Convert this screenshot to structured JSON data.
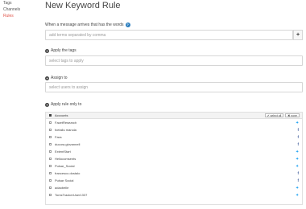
{
  "sidebar": {
    "items": [
      {
        "label": "Tags",
        "active": false
      },
      {
        "label": "Channels",
        "active": false
      },
      {
        "label": "Rules",
        "active": true
      }
    ]
  },
  "page": {
    "title": "New Keyword Rule"
  },
  "keywords": {
    "label": "When a message arrives that has the words",
    "placeholder": "add terms separated by comma",
    "add_button": "+"
  },
  "apply_tags": {
    "label": "Apply the tags",
    "placeholder": "select tags to apply"
  },
  "assign": {
    "label": "Assign to",
    "placeholder": "select users to assign"
  },
  "apply_rule": {
    "label": "Apply rule only to",
    "header_label": "Accounts",
    "select_all": "select all",
    "none": "none",
    "accounts": [
      {
        "name": "FacetResearch",
        "network": "twitter"
      },
      {
        "name": "fcetallu manola",
        "network": "facebook"
      },
      {
        "name": "Facs",
        "network": "facebook"
      },
      {
        "name": "ducora.giovannell",
        "network": "facebook"
      },
      {
        "name": "ExtentStart",
        "network": "twitter"
      },
      {
        "name": "Hellocomsents",
        "network": "twitter"
      },
      {
        "name": "Pulsar_Social",
        "network": "twitter"
      },
      {
        "name": "francesco.dostalo",
        "network": "facebook"
      },
      {
        "name": "Pulsar Social",
        "network": "facebook"
      },
      {
        "name": "adaobelle",
        "network": "twitter"
      },
      {
        "name": "TomsTrackerUser1337",
        "network": "twitter"
      }
    ]
  },
  "colors": {
    "accent": "#e0554a",
    "help": "#2d7fbf",
    "twitter": "#1da1f2",
    "facebook": "#3b5998"
  }
}
